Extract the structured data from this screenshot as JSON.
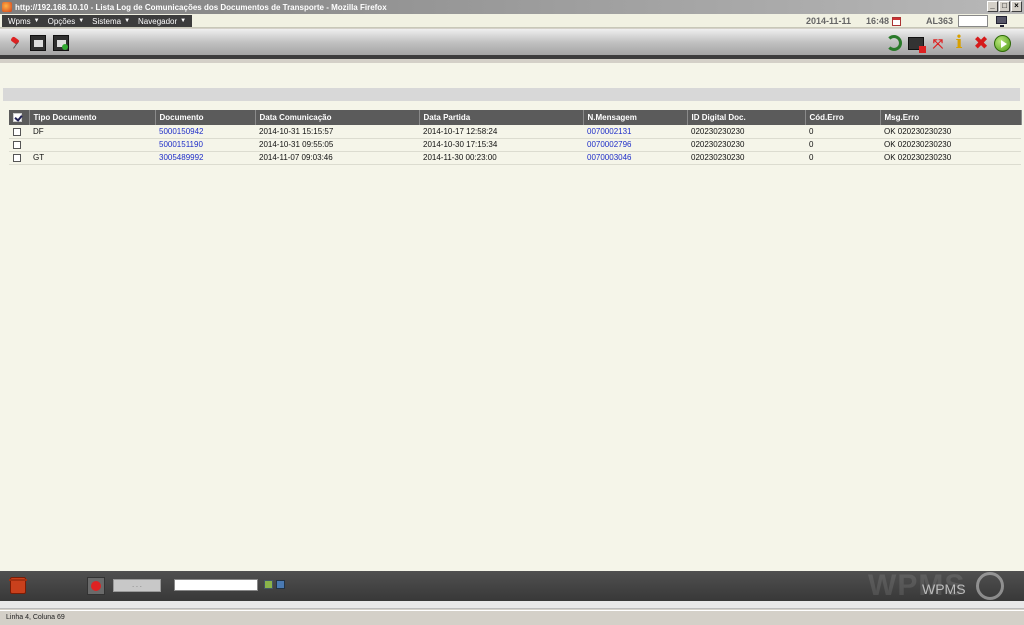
{
  "window": {
    "title": "http://192.168.10.10 - Lista Log de Comunicações dos Documentos de Transporte - Mozilla Firefox"
  },
  "menu": {
    "items": [
      {
        "label": "Wpms"
      },
      {
        "label": "Opções"
      },
      {
        "label": "Sistema"
      },
      {
        "label": "Navegador"
      }
    ]
  },
  "header": {
    "date": "2014-11-11",
    "time": "16:48",
    "user": "AL363"
  },
  "table": {
    "columns": [
      "Tipo Documento",
      "Documento",
      "Data Comunicação",
      "Data Partida",
      "N.Mensagem",
      "ID Digital Doc.",
      "Cód.Erro",
      "Msg.Erro"
    ],
    "rows": [
      {
        "tipo": "DF",
        "documento": "5000150942",
        "data_comunicacao": "2014-10-31  15:15:57",
        "data_partida": "2014-10-17  12:58:24",
        "mensagem": "0070002131",
        "id_digital": "020230230230",
        "cod_erro": "0",
        "msg_erro": "OK 020230230230"
      },
      {
        "tipo": "",
        "documento": "5000151190",
        "data_comunicacao": "2014-10-31  09:55:05",
        "data_partida": "2014-10-30  17:15:34",
        "mensagem": "0070002796",
        "id_digital": "020230230230",
        "cod_erro": "0",
        "msg_erro": "OK 020230230230"
      },
      {
        "tipo": "GT",
        "documento": "3005489992",
        "data_comunicacao": "2014-11-07  09:03:46",
        "data_partida": "2014-11-30  00:23:00",
        "mensagem": "0070003046",
        "id_digital": "020230230230",
        "cod_erro": "0",
        "msg_erro": "OK 020230230230"
      }
    ]
  },
  "bottombar": {
    "field_label": ". . .",
    "watermark_big": "WPMS",
    "watermark_small": "WPMS"
  },
  "status": {
    "text": "Linha 4, Coluna 69"
  },
  "icons": {
    "toolbar_left": [
      "pin-icon",
      "storage-icon",
      "envelope-icon"
    ],
    "toolbar_right": [
      "refresh-icon",
      "monitor-alert-icon",
      "expand-icon",
      "info-icon",
      "close-icon",
      "go-icon"
    ],
    "bottom": [
      "trash-icon",
      "bug-icon",
      "export-icon",
      "print-icon"
    ]
  },
  "colors": {
    "link": "#1f2ec8",
    "header_bg": "#5b5b5b",
    "content_bg": "#f5f5e9"
  }
}
